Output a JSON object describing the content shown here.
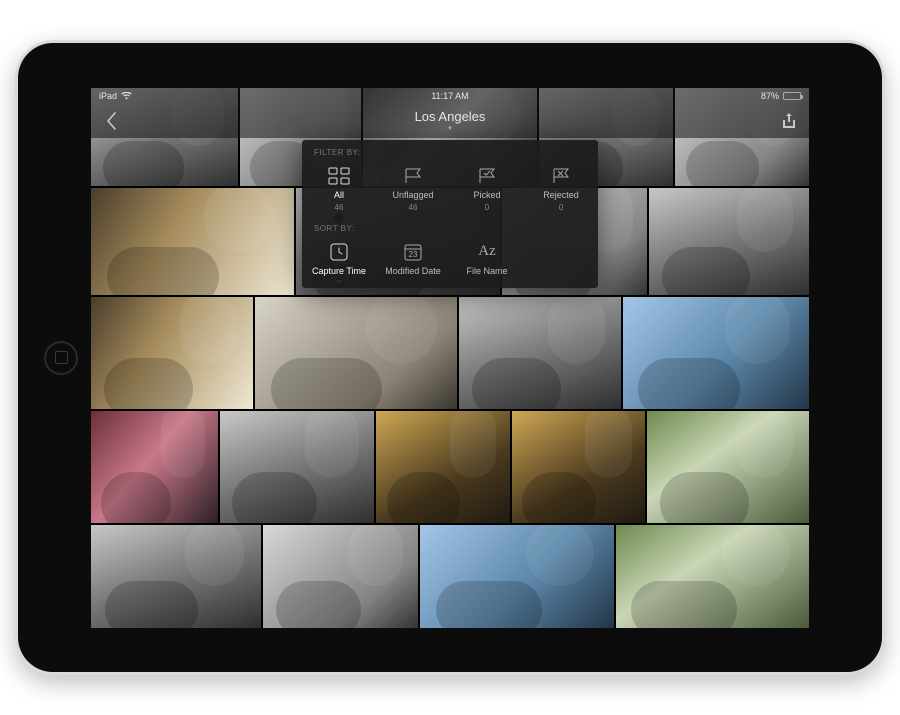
{
  "status": {
    "carrier": "iPad",
    "time": "11:17 AM",
    "battery_pct": "87%"
  },
  "nav": {
    "title": "Los Angeles"
  },
  "popover": {
    "filter_label": "FILTER BY:",
    "sort_label": "SORT BY:",
    "filters": [
      {
        "label": "All",
        "count": "46",
        "active": true
      },
      {
        "label": "Unflagged",
        "count": "46",
        "active": false
      },
      {
        "label": "Picked",
        "count": "0",
        "active": false
      },
      {
        "label": "Rejected",
        "count": "0",
        "active": false
      }
    ],
    "sorts": [
      {
        "label": "Capture Time",
        "active": true
      },
      {
        "label": "Modified Date",
        "active": false
      },
      {
        "label": "File Name",
        "active": false
      }
    ]
  }
}
